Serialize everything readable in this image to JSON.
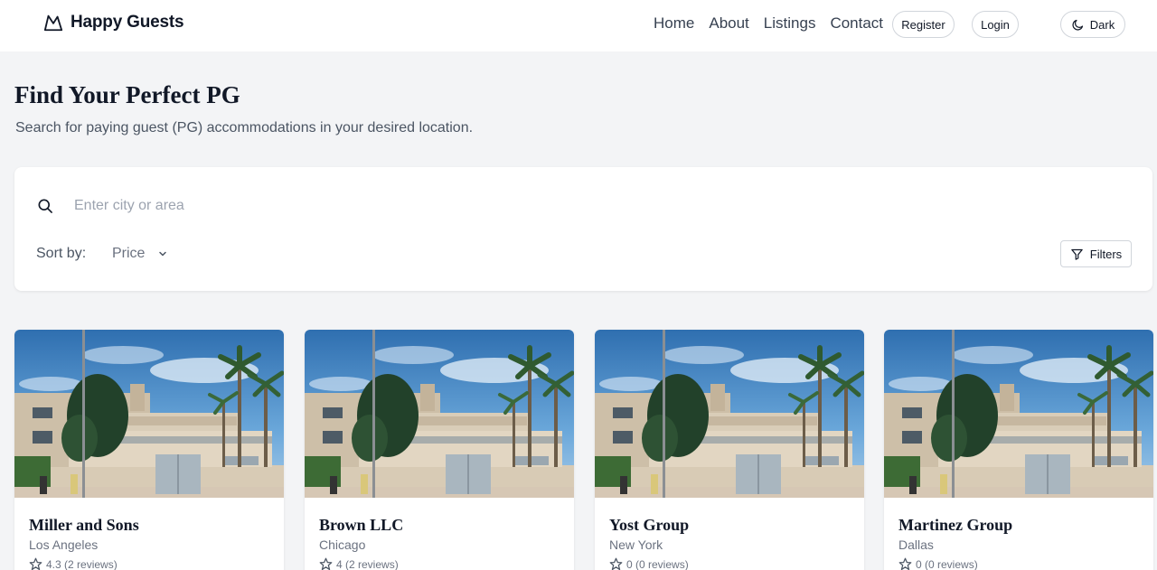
{
  "brand": {
    "name": "Happy Guests",
    "logo_icon": "mountain-logo-icon"
  },
  "nav": {
    "home": "Home",
    "about": "About",
    "listings": "Listings",
    "contact": "Contact"
  },
  "auth": {
    "register": "Register",
    "login": "Login"
  },
  "theme": {
    "label": "Dark",
    "icon": "moon-icon"
  },
  "page": {
    "title": "Find Your Perfect PG",
    "subtitle": "Search for paying guest (PG) accommodations in your desired location."
  },
  "search": {
    "placeholder": "Enter city or area",
    "value": "",
    "sort_label": "Sort by:",
    "sort_value": "Price",
    "filters_label": "Filters"
  },
  "listings": [
    {
      "name": "Miller and Sons",
      "city": "Los Angeles",
      "rating_text": "4.3 (2 reviews)"
    },
    {
      "name": "Brown LLC",
      "city": "Chicago",
      "rating_text": "4 (2 reviews)"
    },
    {
      "name": "Yost Group",
      "city": "New York",
      "rating_text": "0 (0 reviews)"
    },
    {
      "name": "Martinez Group",
      "city": "Dallas",
      "rating_text": "0 (0 reviews)"
    }
  ],
  "colors": {
    "background": "#f3f4f6",
    "card": "#ffffff",
    "text": "#111827",
    "muted": "#6b7280"
  }
}
